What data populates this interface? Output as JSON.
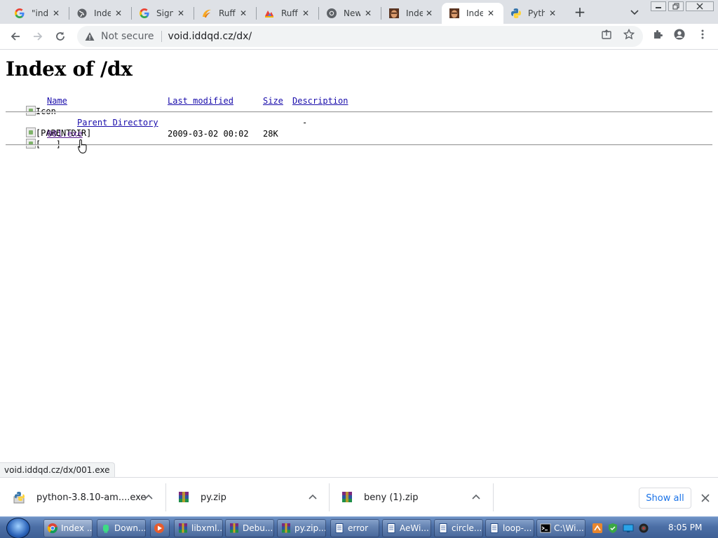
{
  "browser": {
    "tabs": [
      {
        "title": "\"ind",
        "favicon": "google-g-icon",
        "active": false
      },
      {
        "title": "Inde",
        "favicon": "globe-icon",
        "active": false
      },
      {
        "title": "Sign",
        "favicon": "google-g-icon",
        "active": false
      },
      {
        "title": "Ruff",
        "favicon": "ruffle-icon",
        "active": false
      },
      {
        "title": "Ruff",
        "favicon": "ruffle-color-icon",
        "active": false
      },
      {
        "title": "New",
        "favicon": "chrome-icon",
        "active": false
      },
      {
        "title": "Inde",
        "favicon": "portrait-icon",
        "active": false
      },
      {
        "title": "Inde",
        "favicon": "portrait-icon",
        "active": true
      },
      {
        "title": "Pyth",
        "favicon": "python-icon",
        "active": false
      }
    ],
    "security_label": "Not secure",
    "url": "void.iddqd.cz/dx/",
    "status_url": "void.iddqd.cz/dx/001.exe"
  },
  "page": {
    "title": "Index of /dx",
    "headers": {
      "icon_alt": "Icon",
      "name": "Name",
      "last_modified": "Last modified",
      "size": "Size",
      "description": "Description"
    },
    "rows": [
      {
        "icon_alt": "[PARENTDIR]",
        "name": "Parent Directory",
        "modified": "",
        "size": "-",
        "description": ""
      },
      {
        "icon_alt": "[   ]",
        "name": "001.exe",
        "modified": "2009-03-02 00:02",
        "size": "28K",
        "description": ""
      }
    ]
  },
  "downloads": {
    "items": [
      {
        "name": "python-3.8.10-am....exe",
        "icon": "python-installer-icon"
      },
      {
        "name": "py.zip",
        "icon": "winrar-icon"
      },
      {
        "name": "beny (1).zip",
        "icon": "winrar-icon"
      }
    ],
    "show_all": "Show all"
  },
  "taskbar": {
    "buttons": [
      {
        "label": "Index ...",
        "icon": "chrome-icon",
        "active": true
      },
      {
        "label": "Down...",
        "icon": "android-icon",
        "active": false
      },
      {
        "label": "",
        "icon": "media-player-icon",
        "active": false
      },
      {
        "label": "libxml...",
        "icon": "winrar-icon",
        "active": false
      },
      {
        "label": "Debu...",
        "icon": "winrar-icon",
        "active": false
      },
      {
        "label": "py.zip...",
        "icon": "winrar-icon",
        "active": false
      },
      {
        "label": "error",
        "icon": "notepad-icon",
        "active": false
      },
      {
        "label": "AeWi...",
        "icon": "notepad-icon",
        "active": false
      },
      {
        "label": "circle...",
        "icon": "notepad-icon",
        "active": false
      },
      {
        "label": "loop-...",
        "icon": "notepad-icon",
        "active": false
      },
      {
        "label": "C:\\Wi...",
        "icon": "cmd-icon",
        "active": false
      }
    ],
    "clock": "8:05 PM"
  },
  "colors": {
    "link": "#1a0dab",
    "visited_link": "#551a8b",
    "tabstrip": "#dee1e6",
    "accent": "#1a73e8"
  }
}
